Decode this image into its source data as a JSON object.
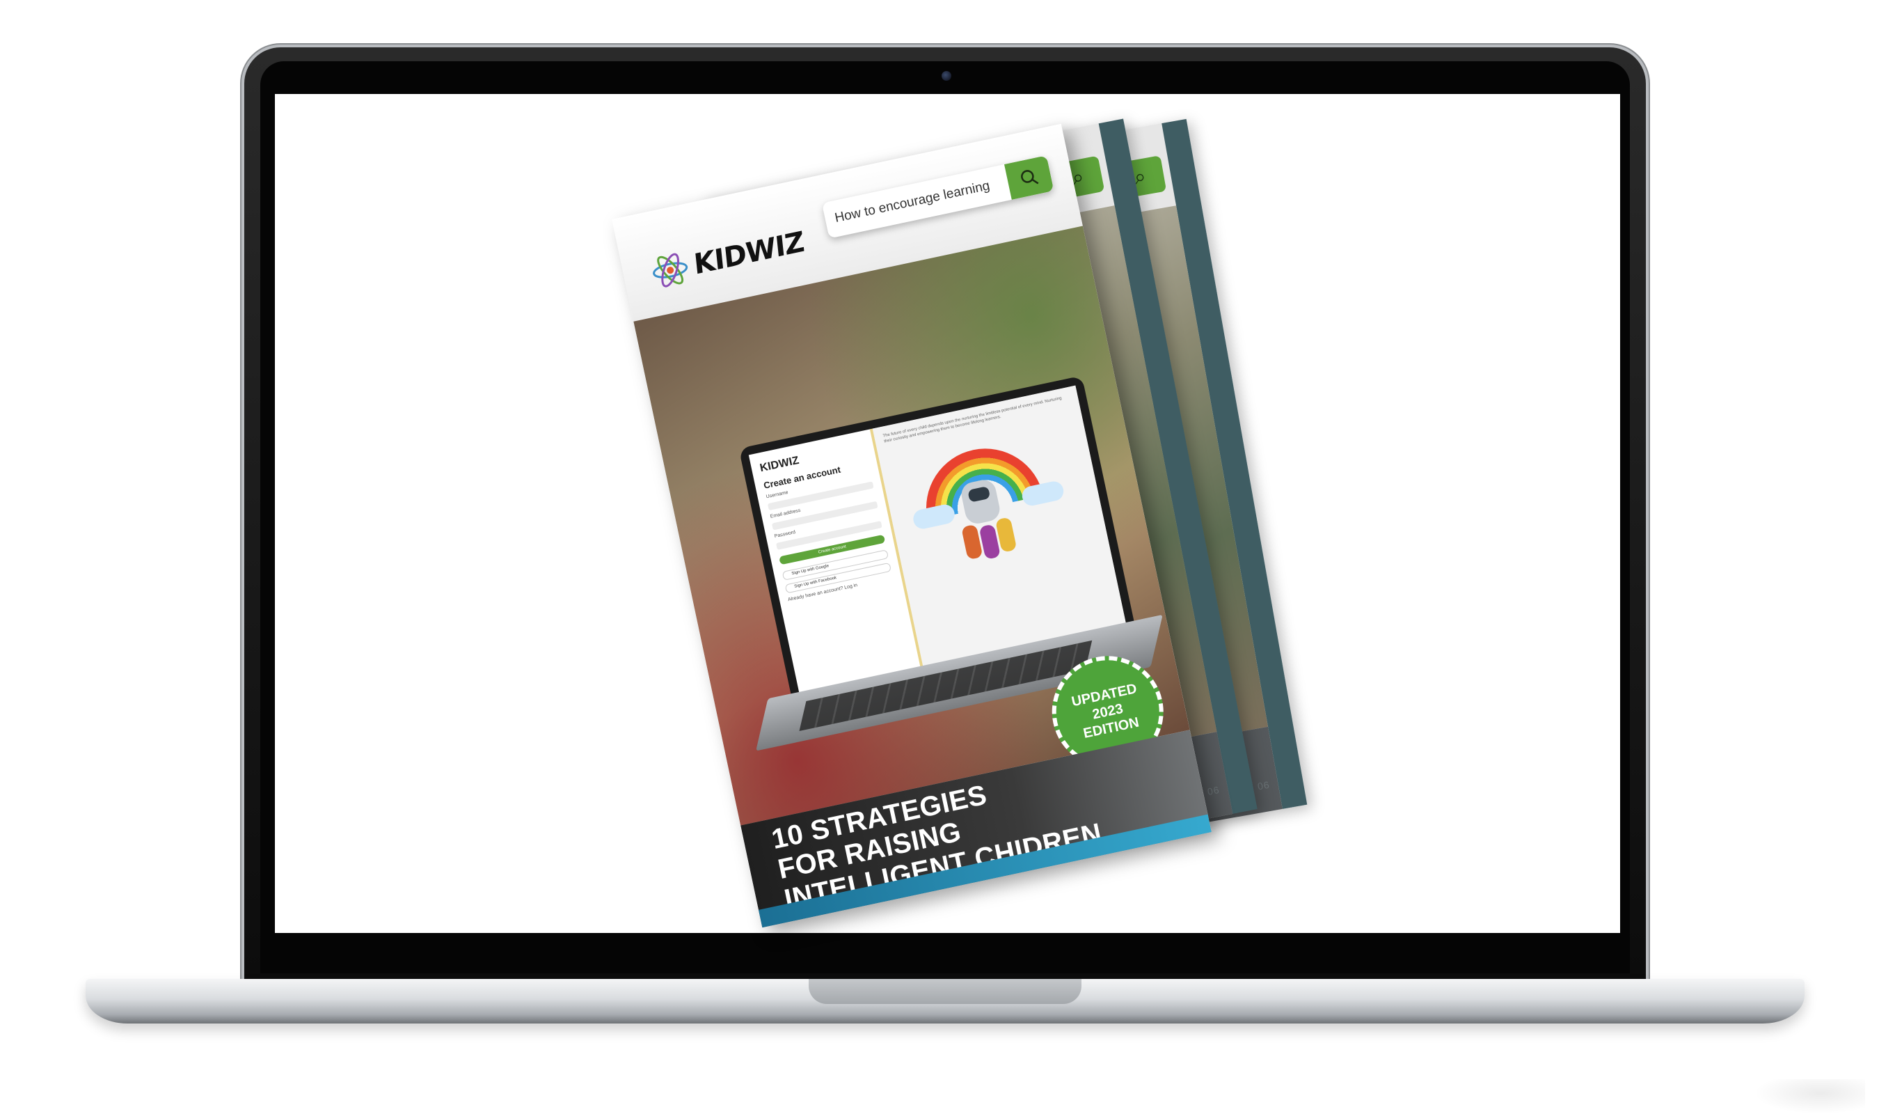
{
  "brochure": {
    "brand": "KIDWIZ",
    "search_text": "How to encourage learning",
    "title_lines": [
      "10 STRATEGIES",
      "FOR RAISING",
      "INTELLIGENT CHIDREN"
    ],
    "badge_lines": [
      "UPDATED",
      "2023",
      "EDITION"
    ],
    "back_page_numbers": [
      "Page 06",
      "Page 06"
    ],
    "inner_screen": {
      "brand": "KIDWIZ",
      "heading": "Create an account",
      "labels": [
        "Username",
        "Email address",
        "Password"
      ],
      "submit_label": "Create account",
      "google_label": "Sign Up with Google",
      "facebook_label": "Sign Up with Facebook",
      "footer_text": "Already have an account? Log in",
      "quote": "The future of every child depends upon the nurturing the limitless potential of every mind. Nurturing their curiosity and empowering them to become lifelong learners."
    }
  },
  "colors": {
    "accent_green": "#5ea43a",
    "footer_teal": "#36a9cf",
    "page_edge": "#3f5d63"
  },
  "icons": {
    "search": "magnifier",
    "logo": "atom"
  }
}
